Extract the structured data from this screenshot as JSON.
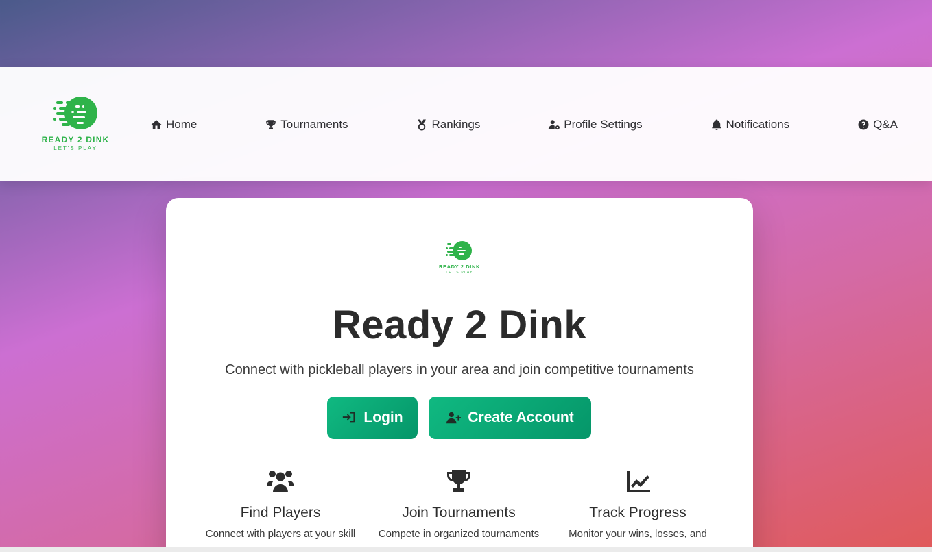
{
  "brand": {
    "name": "READY 2 DINK",
    "tagline": "LET'S PLAY",
    "color": "#2fb34a"
  },
  "nav": {
    "items": [
      {
        "label": "Home",
        "icon": "home-icon"
      },
      {
        "label": "Tournaments",
        "icon": "trophy-icon"
      },
      {
        "label": "Rankings",
        "icon": "medal-icon"
      },
      {
        "label": "Profile Settings",
        "icon": "user-gear-icon"
      },
      {
        "label": "Notifications",
        "icon": "bell-icon"
      },
      {
        "label": "Q&A",
        "icon": "question-circle-icon"
      }
    ]
  },
  "hero": {
    "title": "Ready 2 Dink",
    "subtitle": "Connect with pickleball players in your area and join competitive tournaments",
    "login_label": "Login",
    "create_label": "Create Account",
    "button_color": "#10b981"
  },
  "features": [
    {
      "title": "Find Players",
      "desc": "Connect with players at your skill",
      "icon": "users-icon"
    },
    {
      "title": "Join Tournaments",
      "desc": "Compete in organized tournaments",
      "icon": "trophy-icon"
    },
    {
      "title": "Track Progress",
      "desc": "Monitor your wins, losses, and",
      "icon": "chart-line-icon"
    }
  ]
}
